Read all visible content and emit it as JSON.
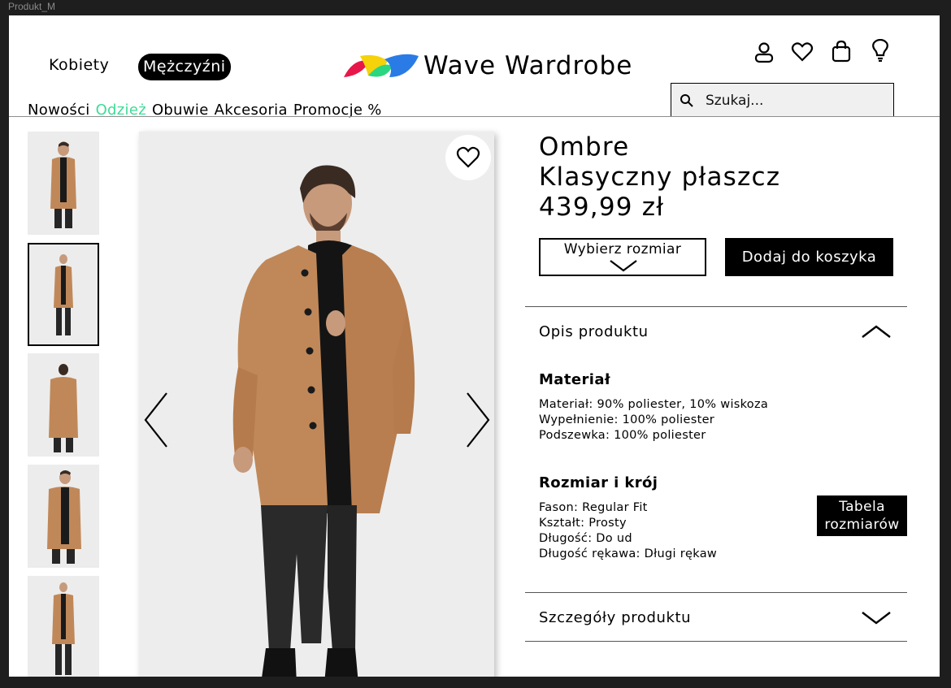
{
  "frame_label": "Produkt_M",
  "header": {
    "gender_women": "Kobiety",
    "gender_men": "Mężczyźni",
    "brand": "Wave Wardrobe",
    "search_placeholder": "Szukaj...",
    "icons": [
      "user-icon",
      "heart-icon",
      "bag-icon",
      "lightbulb-icon"
    ],
    "nav": [
      {
        "label": "Nowości",
        "active": false
      },
      {
        "label": "Odzież",
        "active": true
      },
      {
        "label": "Obuwie",
        "active": false
      },
      {
        "label": "Akcesoria",
        "active": false
      },
      {
        "label": "Promocje %",
        "active": false
      }
    ],
    "accent_color": "#3ddc97",
    "logo_colors": [
      "#e8174a",
      "#f5d20a",
      "#2bd680",
      "#2a7be6"
    ]
  },
  "gallery": {
    "thumbnail_count": 5,
    "selected_index": 1
  },
  "product": {
    "title_line1": "Ombre",
    "title_line2": "Klasyczny płaszcz",
    "price": "439,99 zł",
    "size_select_label": "Wybierz rozmiar",
    "add_to_cart": "Dodaj do koszyka",
    "accordion_description": "Opis produktu",
    "material_heading": "Materiał",
    "material": [
      {
        "key": "Materiał",
        "value": "90% poliester, 10% wiskoza"
      },
      {
        "key": "Wypełnienie",
        "value": "100% poliester"
      },
      {
        "key": "Podszewka",
        "value": "100% poliester"
      }
    ],
    "fit_heading": "Rozmiar i krój",
    "fit": [
      {
        "key": "Fason",
        "value": "Regular Fit"
      },
      {
        "key": "Kształt",
        "value": "Prosty"
      },
      {
        "key": "Długość",
        "value": "Do ud"
      },
      {
        "key": "Długość rękawa",
        "value": "Długi rękaw"
      }
    ],
    "size_table_line1": "Tabela",
    "size_table_line2": "rozmiarów",
    "accordion_details": "Szczegóły produktu"
  }
}
